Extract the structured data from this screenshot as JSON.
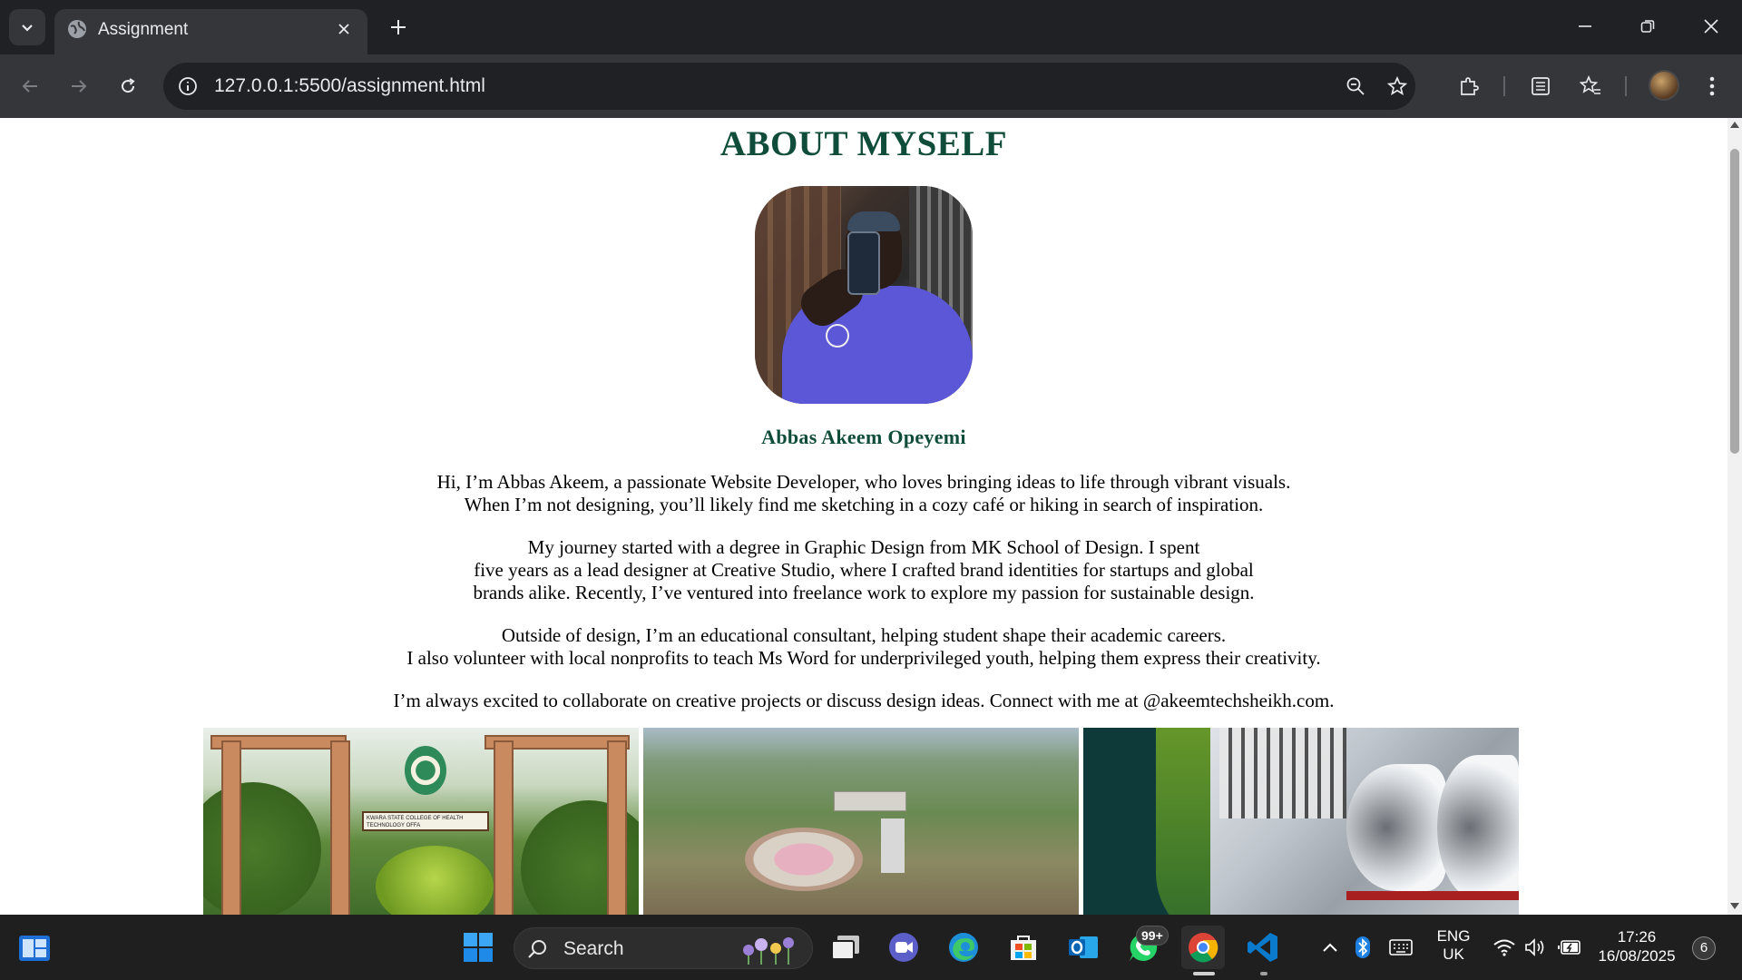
{
  "browser": {
    "tab": {
      "title": "Assignment"
    },
    "url": {
      "host": "127.0.0.1",
      "path": ":5500/assignment.html"
    }
  },
  "page": {
    "heading": "ABOUT MYSELF",
    "name": "Abbas Akeem Opeyemi",
    "paragraphs": [
      [
        "Hi, I’m Abbas Akeem, a passionate Website Developer, who loves bringing ideas to life through vibrant visuals.",
        "When I’m not designing, you’ll likely find me sketching in a cozy café or hiking in search of inspiration."
      ],
      [
        "My journey started with a degree in Graphic Design from MK School of Design. I spent",
        "five years as a lead designer at Creative Studio, where I crafted brand identities for startups and global",
        "brands alike. Recently, I’ve ventured into freelance work to explore my passion for sustainable design."
      ],
      [
        "Outside of design, I’m an educational consultant, helping student shape their academic careers.",
        "I also volunteer with local nonprofits to teach Ms Word for underprivileged youth, helping them express their creativity."
      ],
      [
        "I’m always excited to collaborate on creative projects or discuss design ideas. Connect with me at @akeemtechsheikh.com."
      ]
    ],
    "gallery": {
      "gate_sign": "KWARA STATE COLLEGE OF HEALTH TECHNOLOGY OFFA"
    }
  },
  "taskbar": {
    "search_label": "Search",
    "whatsapp_badge": "99+",
    "language": {
      "line1": "ENG",
      "line2": "UK"
    },
    "time": "17:26",
    "date": "16/08/2025",
    "notifications": "6"
  },
  "colors": {
    "heading": "#0f4d3a",
    "chrome_dark": "#202124",
    "chrome_toolbar": "#35363a"
  }
}
